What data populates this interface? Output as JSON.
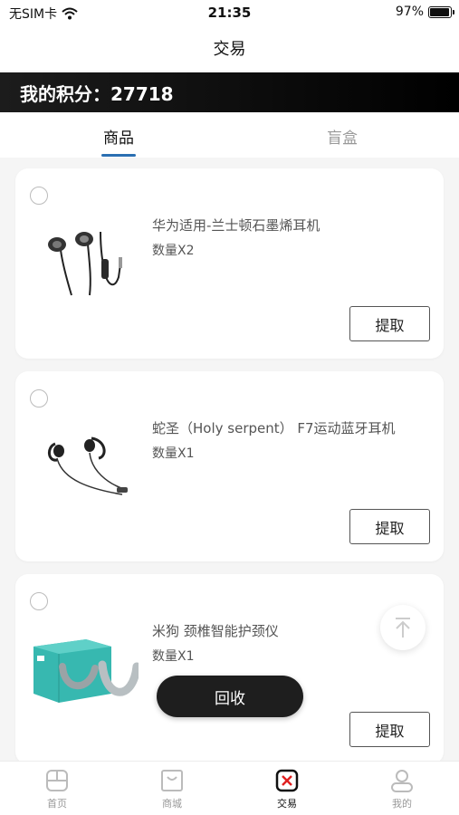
{
  "status_bar": {
    "carrier": "无SIM卡",
    "time": "21:35",
    "battery": "97%",
    "battery_level": 0.97
  },
  "nav": {
    "title": "交易"
  },
  "points": {
    "text": "我的积分：27718"
  },
  "tabs": [
    {
      "label": "商品",
      "active": true
    },
    {
      "label": "盲盒",
      "active": false
    }
  ],
  "items": [
    {
      "name": "华为适用-兰士顿石墨烯耳机",
      "qty": "数量X2",
      "button": "提取",
      "icon": "wired-earphones-image"
    },
    {
      "name": "蛇圣（Holy serpent） F7运动蓝牙耳机",
      "qty": "数量X1",
      "button": "提取",
      "icon": "sport-bluetooth-earphones-image"
    },
    {
      "name": "米狗 颈椎智能护颈仪",
      "qty": "数量X1",
      "button": "提取",
      "icon": "neck-massager-image"
    }
  ],
  "recycle_button": "回收",
  "tabbar": [
    {
      "label": "首页",
      "icon": "home-icon",
      "active": false
    },
    {
      "label": "商城",
      "icon": "mall-icon",
      "active": false
    },
    {
      "label": "交易",
      "icon": "trade-icon",
      "active": true
    },
    {
      "label": "我的",
      "icon": "profile-icon",
      "active": false
    }
  ],
  "colors": {
    "accent": "#2a6fb2",
    "banner": "#111111",
    "recycle": "#1e1e1e"
  }
}
